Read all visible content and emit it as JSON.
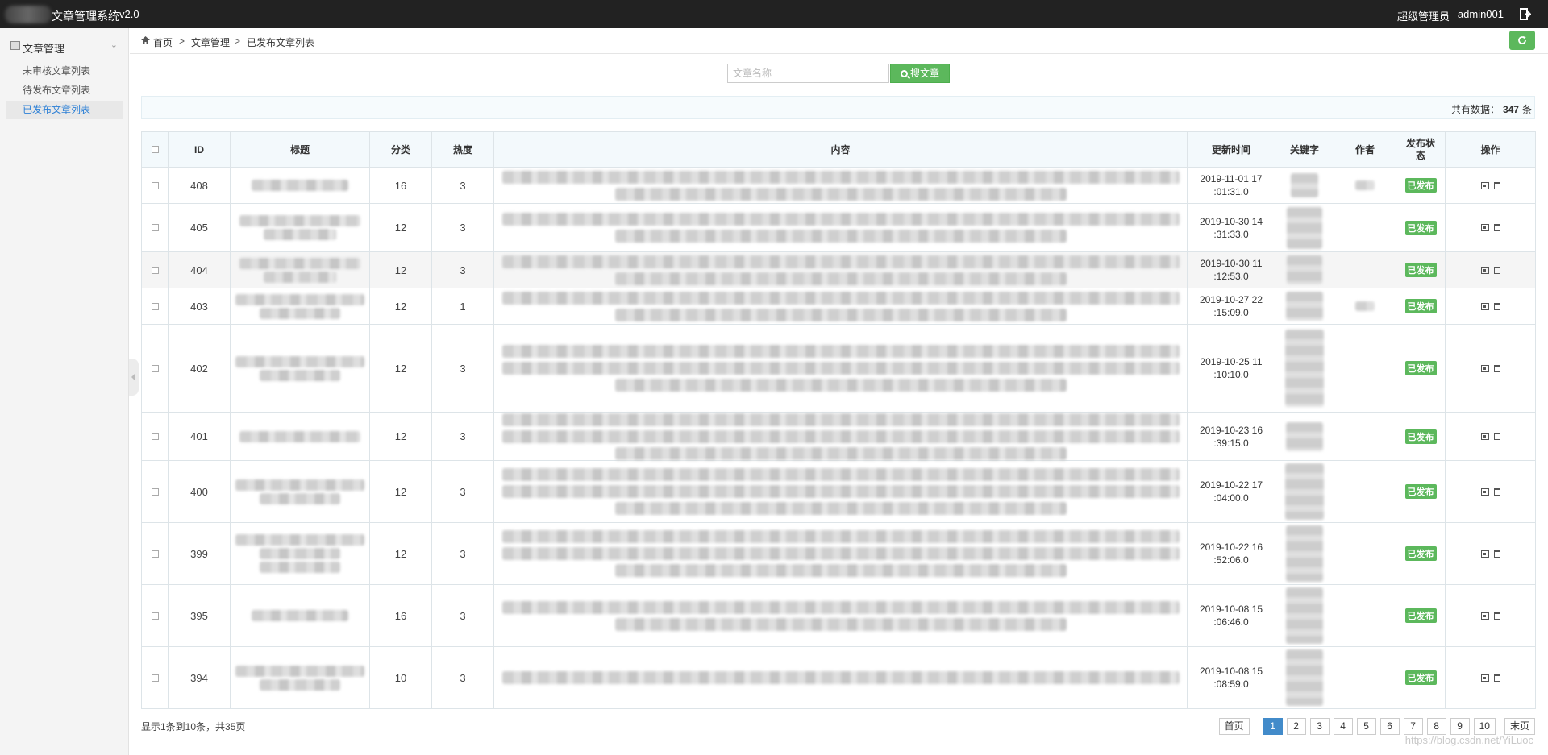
{
  "app": {
    "title": "文章管理系统",
    "version": "v2.0"
  },
  "user": {
    "role": "超级管理员",
    "name": "admin001"
  },
  "sidebar": {
    "menu_title": "文章管理",
    "items": [
      {
        "label": "未审核文章列表",
        "active": false
      },
      {
        "label": "待发布文章列表",
        "active": false
      },
      {
        "label": "已发布文章列表",
        "active": true
      }
    ]
  },
  "breadcrumb": {
    "home": "首页",
    "section": "文章管理",
    "current": "已发布文章列表",
    "separator": ">"
  },
  "search": {
    "placeholder": "文章名称",
    "button_label": "搜文章"
  },
  "summary": {
    "label": "共有数据：",
    "count": "347",
    "unit": "条"
  },
  "table": {
    "headers": {
      "id": "ID",
      "title": "标题",
      "category": "分类",
      "hot": "热度",
      "content": "内容",
      "updated": "更新时间",
      "keyword": "关键字",
      "author": "作者",
      "status": "发布状态",
      "actions": "操作"
    },
    "rows": [
      {
        "id": "408",
        "category": "16",
        "hot": "3",
        "updated": "2019-11-01 17:01:31.0",
        "status": "已发布"
      },
      {
        "id": "405",
        "category": "12",
        "hot": "3",
        "updated": "2019-10-30 14:31:33.0",
        "status": "已发布"
      },
      {
        "id": "404",
        "category": "12",
        "hot": "3",
        "updated": "2019-10-30 11:12:53.0",
        "status": "已发布"
      },
      {
        "id": "403",
        "category": "12",
        "hot": "1",
        "updated": "2019-10-27 22:15:09.0",
        "status": "已发布"
      },
      {
        "id": "402",
        "category": "12",
        "hot": "3",
        "updated": "2019-10-25 11:10:10.0",
        "status": "已发布"
      },
      {
        "id": "401",
        "category": "12",
        "hot": "3",
        "updated": "2019-10-23 16:39:15.0",
        "status": "已发布"
      },
      {
        "id": "400",
        "category": "12",
        "hot": "3",
        "updated": "2019-10-22 17:04:00.0",
        "status": "已发布"
      },
      {
        "id": "399",
        "category": "12",
        "hot": "3",
        "updated": "2019-10-22 16:52:06.0",
        "status": "已发布"
      },
      {
        "id": "395",
        "category": "16",
        "hot": "3",
        "updated": "2019-10-08 15:06:46.0",
        "status": "已发布"
      },
      {
        "id": "394",
        "category": "10",
        "hot": "3",
        "updated": "2019-10-08 15:08:59.0",
        "status": "已发布"
      }
    ]
  },
  "pagination": {
    "info": "显示1条到10条，共35页",
    "first": "首页",
    "pages": [
      "1",
      "2",
      "3",
      "4",
      "5",
      "6",
      "7",
      "8",
      "9",
      "10"
    ],
    "current_page": "1",
    "last": "末页"
  },
  "watermark": "https://blog.csdn.net/YiLuoc"
}
